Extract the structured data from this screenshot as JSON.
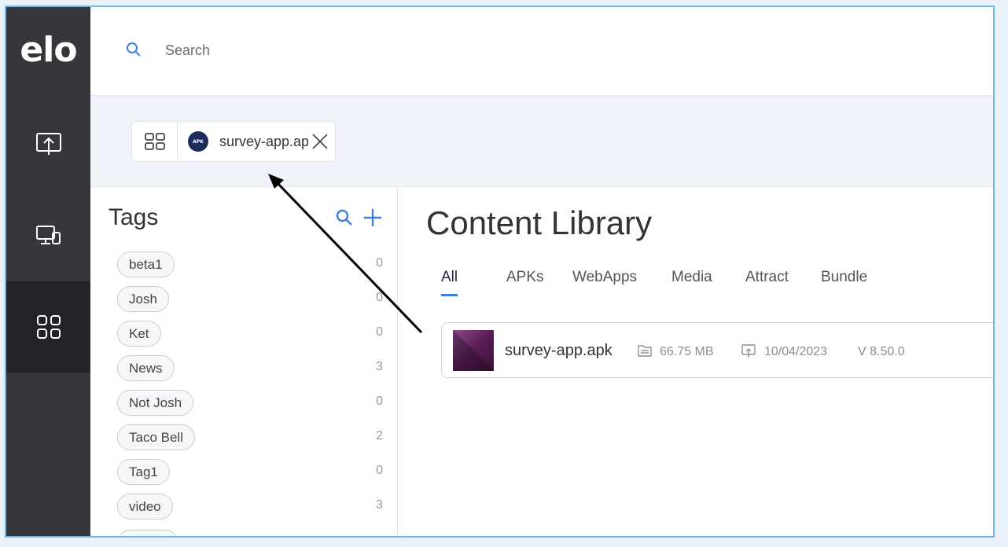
{
  "brand": {
    "logo_text": "elo"
  },
  "header": {
    "search_placeholder": "Search"
  },
  "open_tab": {
    "label": "survey-app.apk",
    "badge": "APK"
  },
  "tags_panel": {
    "title": "Tags",
    "tags": [
      {
        "name": "beta1",
        "count": "0"
      },
      {
        "name": "Josh",
        "count": "0"
      },
      {
        "name": "Ket",
        "count": "0"
      },
      {
        "name": "News",
        "count": "3"
      },
      {
        "name": "Not Josh",
        "count": "0"
      },
      {
        "name": "Taco Bell",
        "count": "2"
      },
      {
        "name": "Tag1",
        "count": "0"
      },
      {
        "name": "video",
        "count": "3"
      }
    ]
  },
  "content": {
    "title": "Content Library",
    "tabs": [
      "All",
      "APKs",
      "WebApps",
      "Media",
      "Attract",
      "Bundle"
    ],
    "items": [
      {
        "name": "survey-app.apk",
        "size": "66.75 MB",
        "date": "10/04/2023",
        "version": "V 8.50.0"
      }
    ]
  },
  "colors": {
    "sidebar": "#35373b",
    "sidebar_active": "#222327",
    "accent": "#3f7fe0",
    "frame_border": "#6fb4ec"
  }
}
